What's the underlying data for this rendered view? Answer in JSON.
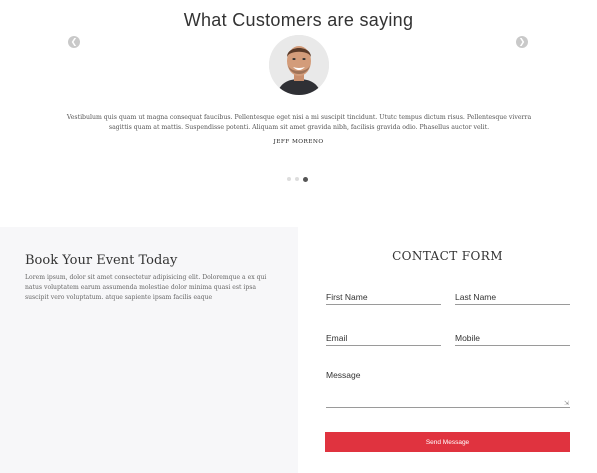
{
  "testimonials": {
    "title": "What Customers are saying",
    "prev_icon": "chevron-left-icon",
    "next_icon": "chevron-right-icon",
    "quote": "Vestibulum quis quam ut magna consequat faucibus. Pellentesque eget nisi a mi suscipit tincidunt. Ututc tempus dictum risus. Pellentesque viverra sagittis quam at mattis. Suspendisse potenti. Aliquam sit amet gravida nibh, facilisis gravida odio. Phasellus auctor velit.",
    "author": "JEFF MORENO",
    "dots_total": 3,
    "active_dot": 3
  },
  "book": {
    "title": "Book Your Event Today",
    "text": "Lorem ipsum, dolor sit amet consectetur adipisicing elit. Doloremque a ex qui natus voluptatem earum assumenda molestiae dolor minima quasi est ipsa suscipit vero voluptatum. atque sapiente ipsam facilis eaque"
  },
  "contact": {
    "title": "CONTACT FORM",
    "first_name_placeholder": "First Name",
    "last_name_placeholder": "Last Name",
    "email_placeholder": "Email",
    "mobile_placeholder": "Mobile",
    "message_placeholder": "Message",
    "send_label": "Send Message"
  },
  "colors": {
    "accent": "#e0333f",
    "panel_bg": "#f7f7f9"
  }
}
